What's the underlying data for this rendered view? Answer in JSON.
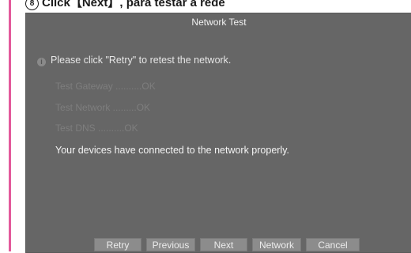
{
  "caption": {
    "step_number": "8",
    "text": "Click【Next】, para testar a rede"
  },
  "dialog": {
    "title": "Network Test",
    "hint": "Please click \"Retry\" to retest the network.",
    "results": [
      "Test Gateway ..........OK",
      "Test Network .........OK",
      "Test DNS ..........OK"
    ],
    "summary": "Your devices have connected to the network properly.",
    "buttons": {
      "retry": "Retry",
      "previous": "Previous",
      "next": "Next",
      "network": "Network",
      "cancel": "Cancel"
    }
  },
  "colors": {
    "accent_rule": "#e35a9c",
    "dialog_bg": "#666666",
    "button_bg": "#8c8c8c"
  }
}
